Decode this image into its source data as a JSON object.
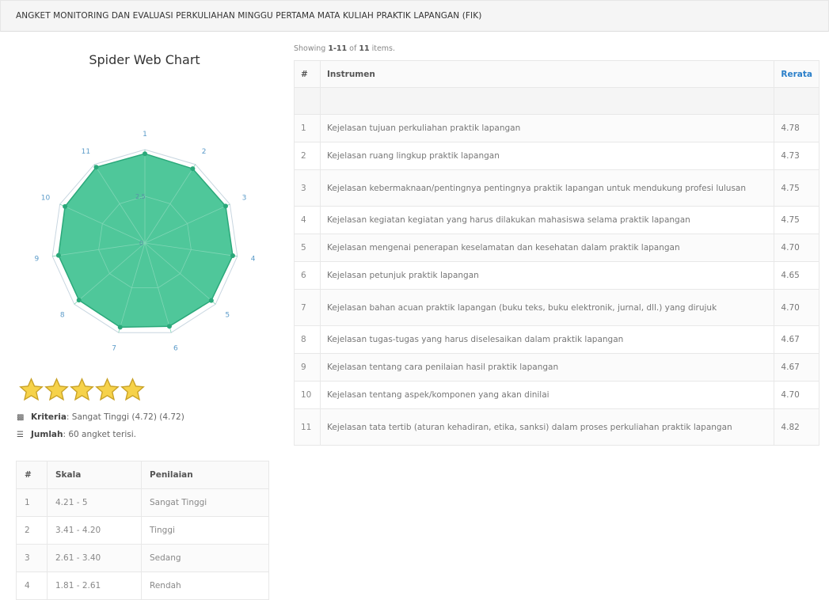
{
  "header": {
    "title": "ANGKET MONITORING DAN EVALUASI PERKULIAHAN MINGGU PERTAMA MATA KULIAH PRAKTIK LAPANGAN (FIK)"
  },
  "chart": {
    "title": "Spider Web Chart",
    "scale_label": "2.5",
    "center_label": "0",
    "fill_color": "#4fc79a",
    "stroke_color": "#2aa87a",
    "max": 5,
    "chart_data": {
      "type": "radar",
      "categories": [
        "1",
        "2",
        "3",
        "4",
        "5",
        "6",
        "7",
        "8",
        "9",
        "10",
        "11"
      ],
      "values": [
        4.78,
        4.73,
        4.75,
        4.75,
        4.7,
        4.65,
        4.7,
        4.67,
        4.67,
        4.7,
        4.82
      ],
      "ylim": [
        0,
        5
      ]
    }
  },
  "rating": {
    "stars": 5,
    "max_stars": 5,
    "star_color": "#f6d24a"
  },
  "kriteria": {
    "label": "Kriteria",
    "value": ": Sangat Tinggi (4.72) (4.72)"
  },
  "jumlah": {
    "label": "Jumlah",
    "value": ": 60 angket terisi."
  },
  "scale_table": {
    "headers": [
      "#",
      "Skala",
      "Penilaian"
    ],
    "rows": [
      [
        "1",
        "4.21 - 5",
        "Sangat Tinggi"
      ],
      [
        "2",
        "3.41 - 4.20",
        "Tinggi"
      ],
      [
        "3",
        "2.61 - 3.40",
        "Sedang"
      ],
      [
        "4",
        "1.81 - 2.61",
        "Rendah"
      ]
    ]
  },
  "items": {
    "summary_prefix": "Showing ",
    "summary_range": "1-11",
    "summary_mid": " of ",
    "summary_total": "11",
    "summary_suffix": " items.",
    "headers": [
      "#",
      "Instrumen",
      "Rerata"
    ],
    "rows": [
      [
        "1",
        "Kejelasan tujuan perkuliahan praktik lapangan",
        "4.78"
      ],
      [
        "2",
        "Kejelasan ruang lingkup praktik lapangan",
        "4.73"
      ],
      [
        "3",
        "Kejelasan kebermaknaan/pentingnya pentingnya praktik lapangan untuk mendukung profesi lulusan",
        "4.75"
      ],
      [
        "4",
        "Kejelasan kegiatan kegiatan yang harus dilakukan mahasiswa selama praktik lapangan",
        "4.75"
      ],
      [
        "5",
        "Kejelasan mengenai penerapan keselamatan dan kesehatan dalam praktik lapangan",
        "4.70"
      ],
      [
        "6",
        "Kejelasan petunjuk praktik lapangan",
        "4.65"
      ],
      [
        "7",
        "Kejelasan bahan acuan praktik lapangan (buku teks, buku elektronik, jurnal, dll.) yang dirujuk",
        "4.70"
      ],
      [
        "8",
        "Kejelasan tugas-tugas yang harus diselesaikan dalam praktik lapangan",
        "4.67"
      ],
      [
        "9",
        "Kejelasan tentang cara penilaian hasil praktik lapangan",
        "4.67"
      ],
      [
        "10",
        "Kejelasan tentang aspek/komponen yang akan dinilai",
        "4.70"
      ],
      [
        "11",
        "Kejelasan tata tertib (aturan kehadiran, etika, sanksi) dalam proses perkuliahan praktik lapangan",
        "4.82"
      ]
    ]
  }
}
